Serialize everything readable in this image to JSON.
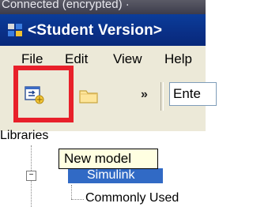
{
  "window": {
    "status_text": "Connected (encrypted) ·",
    "title": "<Student Version>"
  },
  "menubar": {
    "items": [
      "File",
      "Edit",
      "View",
      "Help"
    ]
  },
  "toolbar": {
    "new_model_icon": "new-model-icon",
    "open_icon": "folder-icon",
    "more_glyph": "»",
    "search_value": "Ente"
  },
  "libraries": {
    "label": "Libraries",
    "tree": {
      "expander_glyph": "−",
      "root": "Simulink",
      "child": "Commonly Used"
    }
  },
  "tooltip": {
    "text": "New model"
  },
  "highlight": {
    "color": "#e8202a"
  }
}
